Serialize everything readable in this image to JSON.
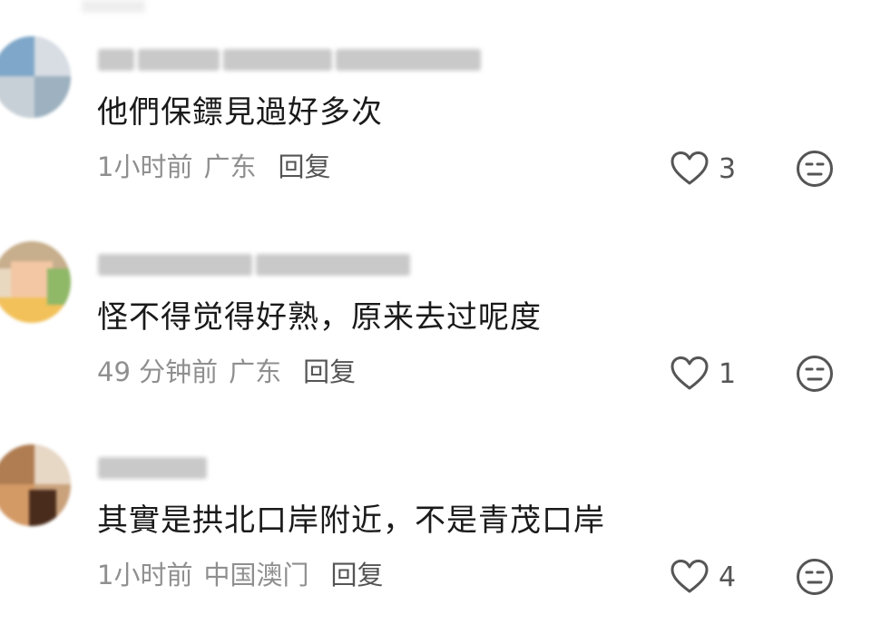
{
  "comments": [
    {
      "text": "他們保鏢見過好多次",
      "time": "1小时前",
      "location": "广东",
      "reply_label": "回复",
      "likes": "3"
    },
    {
      "text": "怪不得觉得好熟，原来去过呢度",
      "time": "49 分钟前",
      "location": "广东",
      "reply_label": "回复",
      "likes": "1"
    },
    {
      "text": "其實是拱北口岸附近，不是青茂口岸",
      "time": "1小时前",
      "location": "中国澳门",
      "reply_label": "回复",
      "likes": "4"
    }
  ],
  "icons": {
    "like": "heart-outline-icon",
    "dislike": "unamused-face-icon"
  },
  "colors": {
    "text": "#1a1a1a",
    "meta": "#8f8f8f",
    "icon": "#555555"
  }
}
